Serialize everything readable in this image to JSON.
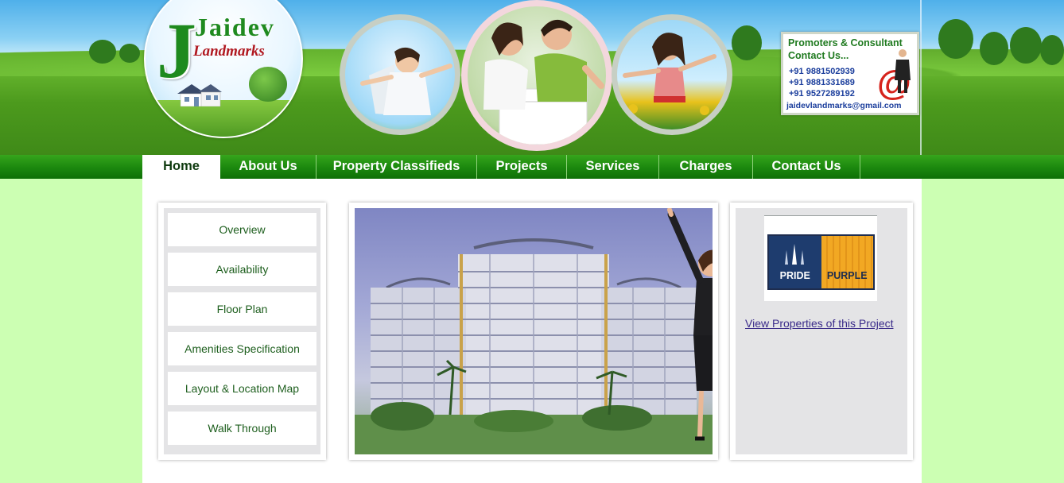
{
  "header": {
    "logo": {
      "title": "Jaidev",
      "subtitle": "Landmarks"
    },
    "contact": {
      "title_line1": "Promoters & Consultant",
      "title_line2": "Contact Us...",
      "phones": [
        "+91 9881502939",
        "+91 9881331689",
        "+91 9527289192"
      ],
      "email": "jaidevlandmarks@gmail.com"
    }
  },
  "nav": {
    "items": [
      {
        "label": "Home",
        "active": true
      },
      {
        "label": "About Us"
      },
      {
        "label": "Property Classifieds"
      },
      {
        "label": "Projects"
      },
      {
        "label": "Services"
      },
      {
        "label": "Charges"
      },
      {
        "label": "Contact Us"
      }
    ]
  },
  "sidebar": {
    "items": [
      {
        "label": "Overview"
      },
      {
        "label": "Availability"
      },
      {
        "label": "Floor Plan"
      },
      {
        "label": "Amenities Specification"
      },
      {
        "label": "Layout & Location Map"
      },
      {
        "label": "Walk Through"
      }
    ]
  },
  "project": {
    "logo_left": "PRIDE",
    "logo_right": "PURPLE",
    "link": "View Properties of this Project"
  },
  "colors": {
    "nav_green": "#1d8a0f",
    "page_bg": "#ccffb3",
    "link": "#3a2b8a"
  }
}
